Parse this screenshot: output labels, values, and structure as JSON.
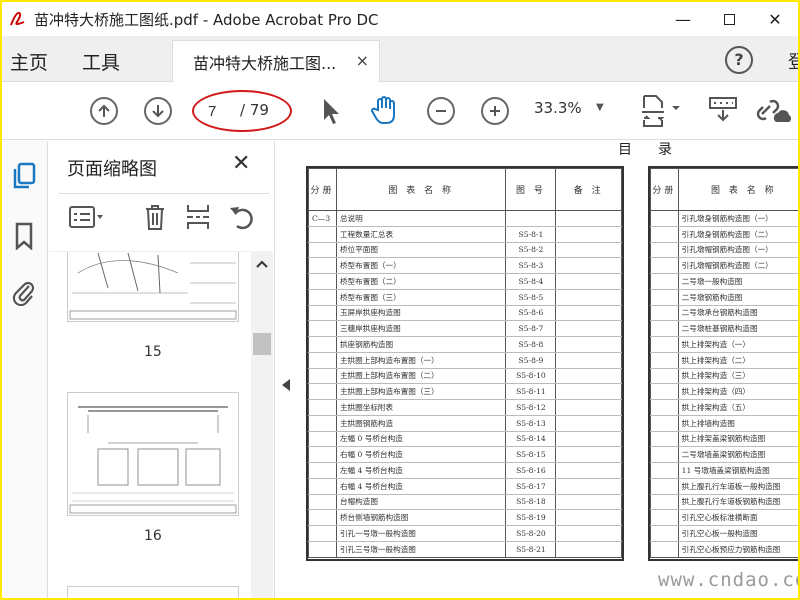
{
  "window": {
    "title": "苗冲特大桥施工图纸.pdf - Adobe Acrobat Pro DC",
    "minimize": "—",
    "close": "✕"
  },
  "menu": {
    "home": "主页",
    "tools": "工具",
    "doc_tab": "苗冲特大桥施工图...",
    "tab_close": "×",
    "help": "?",
    "login": "登"
  },
  "toolbar": {
    "page_current": "7",
    "page_total": "/ 79",
    "zoom": "33.3%",
    "zoom_caret": "▼",
    "highlight_color": "#d21a1a"
  },
  "thumbs": {
    "title": "页面缩略图",
    "close": "✕",
    "pages": [
      "15",
      "16"
    ]
  },
  "document": {
    "heading_left": "目",
    "heading_right": "录",
    "left_table": {
      "headers": [
        "分册",
        "图 表 名 称",
        "图 号",
        "备 注"
      ],
      "rows": [
        [
          "C—3",
          "总说明",
          "",
          ""
        ],
        [
          "",
          "工程数量汇总表",
          "S5-8-1",
          ""
        ],
        [
          "",
          "桥位平面图",
          "S5-8-2",
          ""
        ],
        [
          "",
          "桥型布置图（一）",
          "S5-8-3",
          ""
        ],
        [
          "",
          "桥型布置图（二）",
          "S5-8-4",
          ""
        ],
        [
          "",
          "桥型布置图（三）",
          "S5-8-5",
          ""
        ],
        [
          "",
          "玉屏岸拱座构造图",
          "S5-8-6",
          ""
        ],
        [
          "",
          "三穗岸拱座构造图",
          "S5-8-7",
          ""
        ],
        [
          "",
          "拱座钢筋构造图",
          "S5-8-8",
          ""
        ],
        [
          "",
          "主拱圈上部构造布置图（一）",
          "S5-8-9",
          ""
        ],
        [
          "",
          "主拱圈上部构造布置图（二）",
          "S5-8-10",
          ""
        ],
        [
          "",
          "主拱圈上部构造布置图（三）",
          "S5-8-11",
          ""
        ],
        [
          "",
          "主拱圈坐标附表",
          "S5-8-12",
          ""
        ],
        [
          "",
          "主拱圈钢筋构造",
          "S5-8-13",
          ""
        ],
        [
          "",
          "左幅 0 号桥台构造",
          "S5-8-14",
          ""
        ],
        [
          "",
          "右幅 0 号桥台构造",
          "S5-8-15",
          ""
        ],
        [
          "",
          "左幅 4 号桥台构造",
          "S5-8-16",
          ""
        ],
        [
          "",
          "右幅 4 号桥台构造",
          "S5-8-17",
          ""
        ],
        [
          "",
          "台帽构造图",
          "S5-8-18",
          ""
        ],
        [
          "",
          "桥台侧墙钢筋构造图",
          "S5-8-19",
          ""
        ],
        [
          "",
          "引孔一号墩一般构造图",
          "S5-8-20",
          ""
        ],
        [
          "",
          "引孔三号墩一般构造图",
          "S5-8-21",
          ""
        ]
      ]
    },
    "right_table": {
      "headers": [
        "分册",
        "图 表 名 称"
      ],
      "rows": [
        "引孔墩身钢筋构造图（一）",
        "引孔墩身钢筋构造图（二）",
        "引孔墩帽钢筋构造图（一）",
        "引孔墩帽钢筋构造图（二）",
        "二号墩一般构造图",
        "二号墩钢筋构造图",
        "二号墩承台钢筋构造图",
        "二号墩桩基钢筋构造图",
        "拱上排架构造（一）",
        "拱上排架构造（二）",
        "拱上排架构造（三）",
        "拱上排架构造（四）",
        "拱上排架构造（五）",
        "拱上排墙构造图",
        "拱上排架盖梁钢筋构造图",
        "二号墩墙盖梁钢筋构造图",
        "11 号墩墙盖梁钢筋构造图",
        "拱上腹孔行车道板一般构造图",
        "拱上腹孔行车道板钢筋构造图",
        "引孔空心板标准横断面",
        "引孔空心板一般构造图",
        "引孔空心板预应力钢筋构造图"
      ]
    },
    "watermark": "www.cndao.com"
  }
}
